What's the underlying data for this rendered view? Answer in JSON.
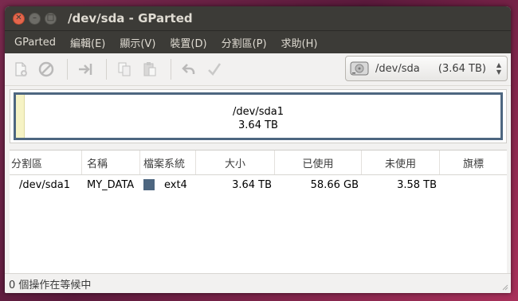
{
  "window": {
    "title": "/dev/sda - GParted"
  },
  "window_controls": {
    "close": "✕",
    "minimize": "–",
    "maximize": "□"
  },
  "menubar": {
    "items": [
      "GParted",
      "編輯(E)",
      "顯示(V)",
      "裝置(D)",
      "分割區(P)",
      "求助(H)"
    ]
  },
  "toolbar": {
    "icons": [
      "new-partition-icon",
      "delete-icon",
      "resize-move-icon",
      "copy-icon",
      "paste-icon",
      "undo-icon",
      "apply-icon"
    ]
  },
  "device_selector": {
    "name": "/dev/sda",
    "size": "(3.64 TB)"
  },
  "partition_map": {
    "partition_name": "/dev/sda1",
    "partition_size": "3.64 TB",
    "used_fraction": 0.016,
    "colors": {
      "border": "#4d6680",
      "used": "#f6f3c5"
    }
  },
  "table": {
    "headers": {
      "partition": "分割區",
      "name": "名稱",
      "filesystem": "檔案系統",
      "size": "大小",
      "used": "已使用",
      "unused": "未使用",
      "flags": "旗標"
    },
    "rows": [
      {
        "partition": "/dev/sda1",
        "name": "MY_DATA",
        "filesystem": "ext4",
        "filesystem_color": "#4d6680",
        "size": "3.64 TB",
        "used": "58.66 GB",
        "unused": "3.58 TB",
        "flags": ""
      }
    ]
  },
  "statusbar": {
    "text": "0 個操作在等候中"
  }
}
